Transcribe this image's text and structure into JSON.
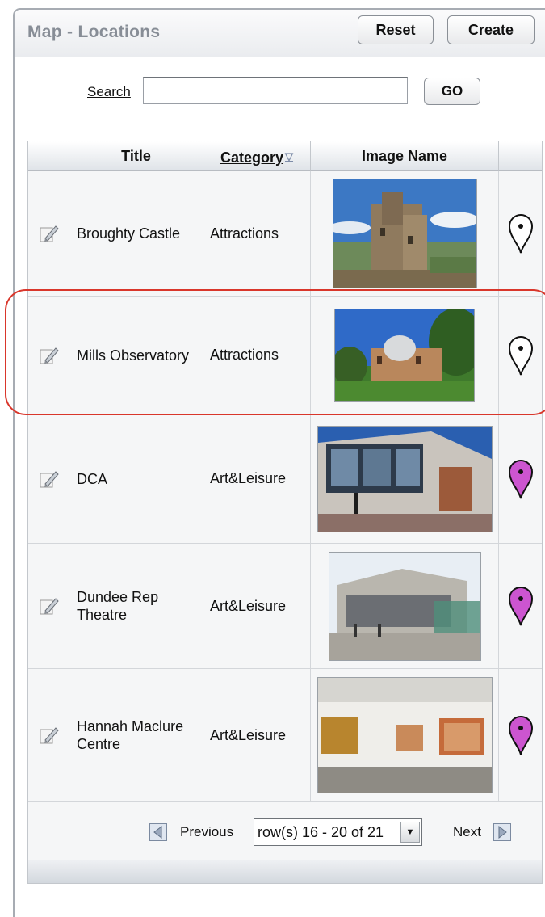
{
  "region": {
    "title": "Map - Locations",
    "reset_label": "Reset",
    "create_label": "Create"
  },
  "search": {
    "label": "Search",
    "value": "",
    "go_label": "GO"
  },
  "report": {
    "columns": [
      {
        "label": "",
        "sortable": false
      },
      {
        "label": "Title",
        "sortable": true
      },
      {
        "label": "Category",
        "sortable": true,
        "sort_indicator": "▽"
      },
      {
        "label": "Image Name",
        "sortable": false
      },
      {
        "label": "",
        "sortable": false
      }
    ],
    "rows": [
      {
        "title": "Broughty Castle",
        "category": "Attractions",
        "image": "castle-photo",
        "pin_color": "#ffffff",
        "edit_icon": "edit-pencil-icon",
        "pin_icon": "map-pin-icon"
      },
      {
        "title": "Mills Observatory",
        "category": "Attractions",
        "image": "observatory-photo",
        "pin_color": "#ffffff",
        "edit_icon": "edit-pencil-icon",
        "pin_icon": "map-pin-icon"
      },
      {
        "title": "DCA",
        "category": "Art&Leisure",
        "image": "dca-photo",
        "pin_color": "#cc55d0",
        "edit_icon": "edit-pencil-icon",
        "pin_icon": "map-pin-icon"
      },
      {
        "title": "Dundee Rep Theatre",
        "category": "Art&Leisure",
        "image": "theatre-photo",
        "pin_color": "#cc55d0",
        "edit_icon": "edit-pencil-icon",
        "pin_icon": "map-pin-icon"
      },
      {
        "title": "Hannah Maclure Centre",
        "category": "Art&Leisure",
        "image": "gallery-photo",
        "pin_color": "#cc55d0",
        "edit_icon": "edit-pencil-icon",
        "pin_icon": "map-pin-icon"
      }
    ],
    "pagination": {
      "previous_label": "Previous",
      "range_label": "row(s) 16 - 20 of 21",
      "next_label": "Next"
    }
  },
  "colors": {
    "highlight": "#d9362b",
    "pin_attractions": "#ffffff",
    "pin_art_leisure": "#cc55d0"
  }
}
